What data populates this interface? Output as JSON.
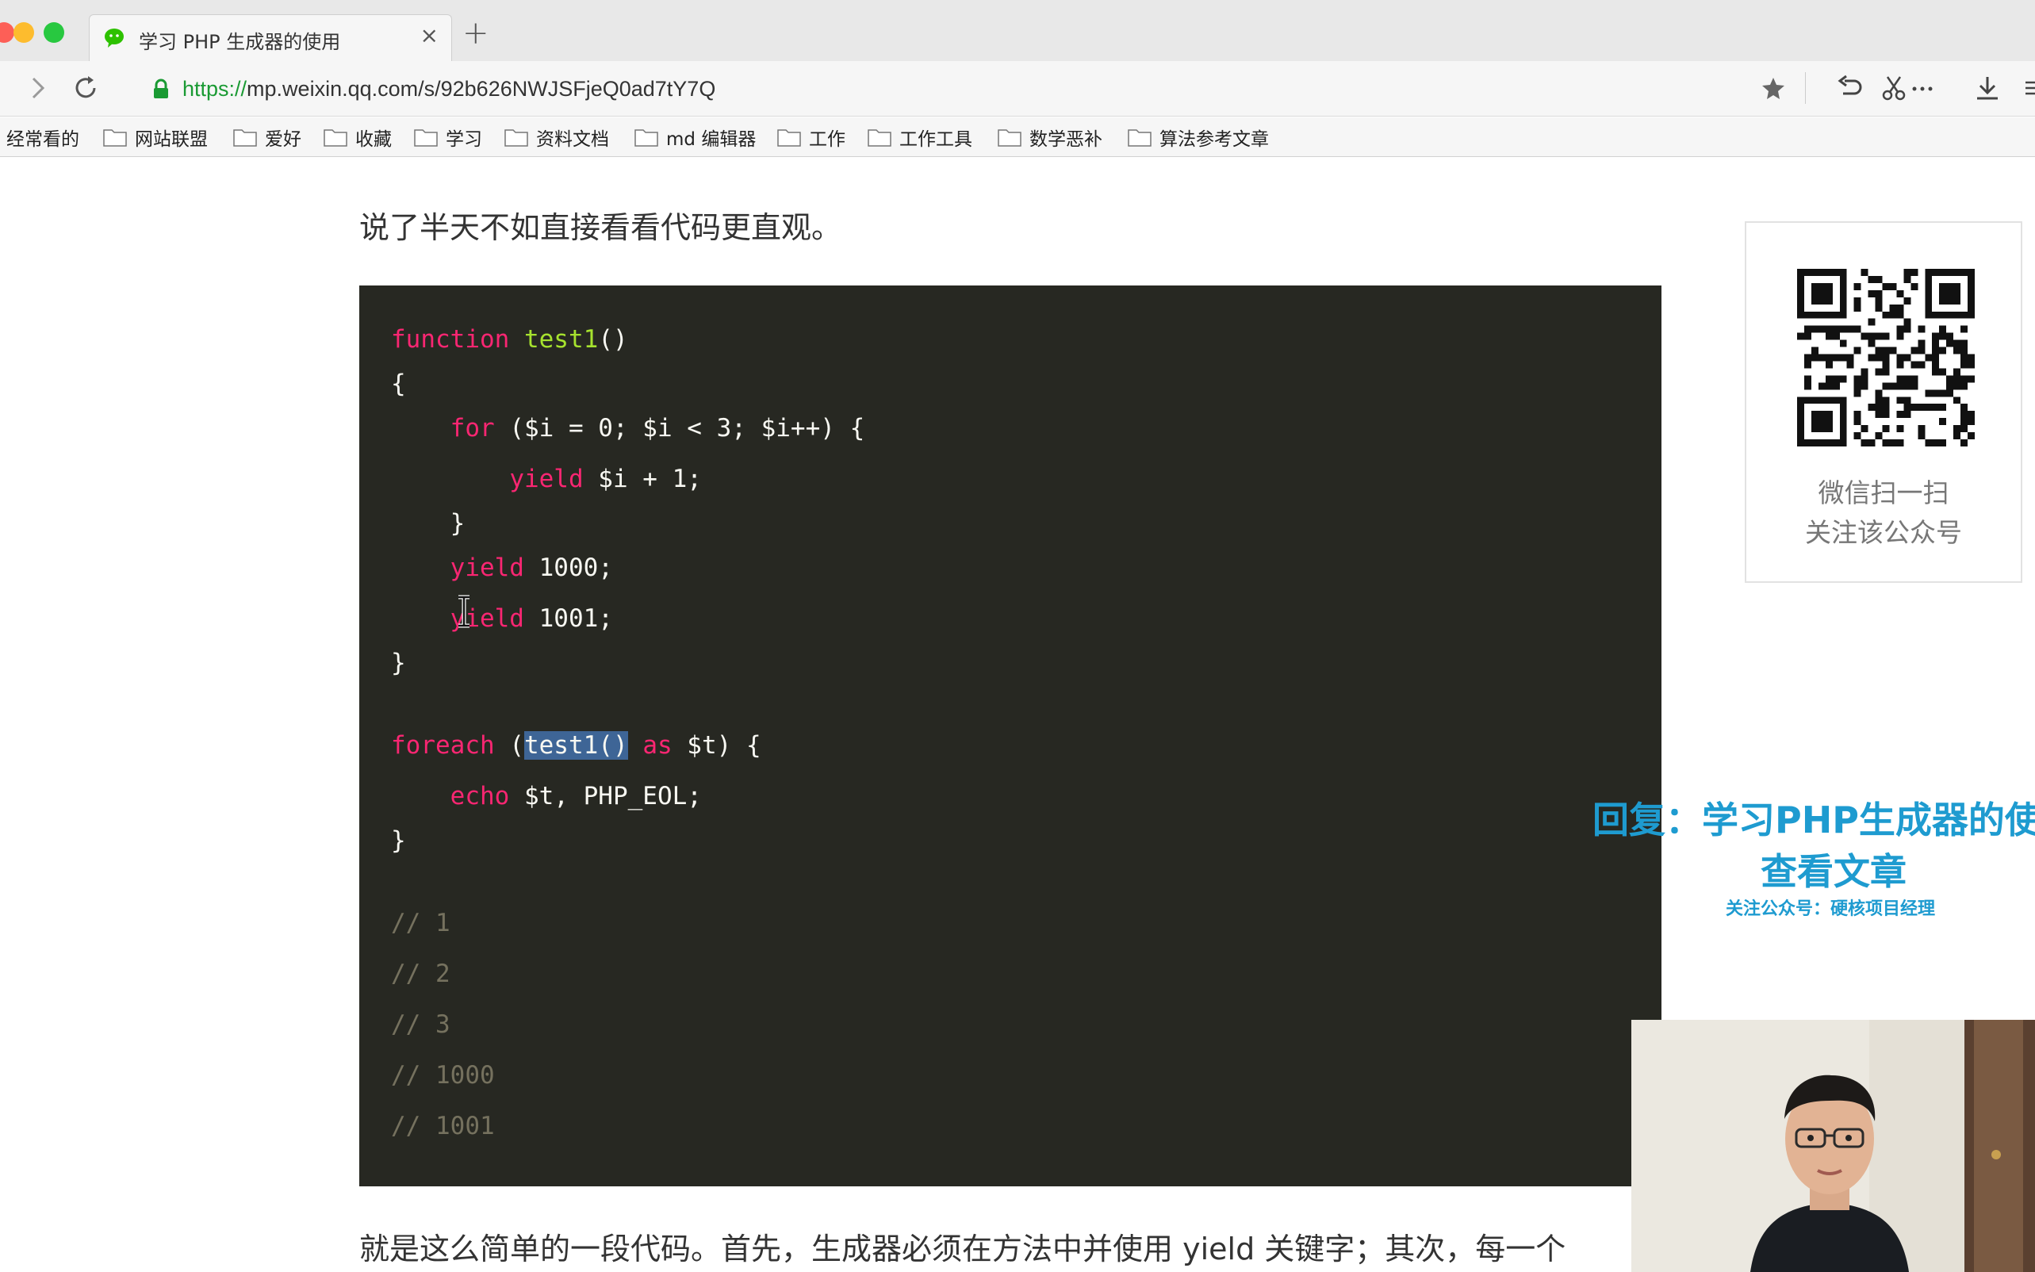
{
  "browser": {
    "tab_title": "学习 PHP 生成器的使用",
    "tab_close": "×",
    "new_tab": "+",
    "url_scheme": "https://",
    "url_rest": "mp.weixin.qq.com/s/92b626NWJSFjeQ0ad7tY7Q",
    "bookmarks_first": "经常看的",
    "bookmarks": [
      "网站联盟",
      "爱好",
      "收藏",
      "学习",
      "资料文档",
      "md 编辑器",
      "工作",
      "工作工具",
      "数学恶补",
      "算法参考文章"
    ]
  },
  "article": {
    "intro": "说了半天不如直接看看代码更直观。",
    "outro": "就是这么简单的一段代码。首先，生成器必须在方法中并使用 yield 关键字；其次，每一个",
    "code": {
      "l1_kw": "function",
      "l1_fn": "test1",
      "l1_rest": "()",
      "l2": "{",
      "l3_indent": "    ",
      "l3_kw": "for",
      "l3_rest": " ($i = 0; $i < 3; $i++) {",
      "l4_indent": "        ",
      "l4_kw": "yield",
      "l4_rest": " $i + 1;",
      "l5": "    }",
      "l6_indent": "    ",
      "l6_kw": "yield",
      "l6_rest": " 1000;",
      "l7_indent": "    ",
      "l7_kw": "yield",
      "l7_rest": " 1001;",
      "l8": "}",
      "l9_kw": "foreach",
      "l9_a": " (",
      "l9_sel": "test1()",
      "l9_b": " ",
      "l9_kw2": "as",
      "l9_c": " $t) {",
      "l10_indent": "    ",
      "l10_kw": "echo",
      "l10_rest": " $t, PHP_EOL;",
      "l11": "}",
      "comments": [
        "// 1",
        "// 2",
        "// 3",
        "// 1000",
        "// 1001"
      ]
    }
  },
  "sidebar": {
    "qr_line1": "微信扫一扫",
    "qr_line2": "关注该公众号",
    "reply_line1": "回复：学习PHP生成器的使",
    "reply_line2": "查看文章",
    "reply_line3": "关注公众号：硬核项目经理"
  },
  "colors": {
    "code_bg": "#272822",
    "keyword": "#f92672",
    "function": "#a6e22e",
    "comment": "#75715e",
    "accent": "#1e9bd0"
  }
}
